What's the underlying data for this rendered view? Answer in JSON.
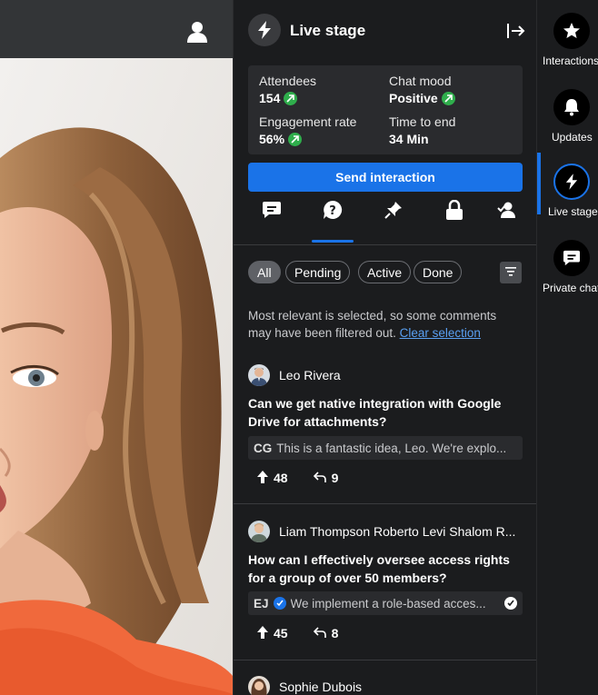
{
  "panel": {
    "title": "Live stage",
    "stats": {
      "attendees_label": "Attendees",
      "attendees_value": "154",
      "chat_mood_label": "Chat mood",
      "chat_mood_value": "Positive",
      "engagement_label": "Engagement rate",
      "engagement_value": "56%",
      "time_label": "Time to end",
      "time_value": "34 Min"
    },
    "send_button": "Send interaction",
    "tabs": [
      "chat-icon",
      "question-icon",
      "pin-icon",
      "lock-icon",
      "people-icon"
    ],
    "active_tab": 1,
    "filters": [
      {
        "label": "All",
        "active": true
      },
      {
        "label": "Pending",
        "active": false
      },
      {
        "label": "Active",
        "active": false
      },
      {
        "label": "Done",
        "active": false
      }
    ],
    "filter_note": "Most relevant is selected, so some comments may have been filtered out.",
    "clear_selection": "Clear selection",
    "questions": [
      {
        "author": "Leo Rivera",
        "question": "Can we get native integration with Google Drive for attachments?",
        "reply_initials": "CG",
        "reply_text": "This is a fantastic idea, Leo. We're explo...",
        "reply_verified": false,
        "reply_done": false,
        "upvotes": "48",
        "replies": "9"
      },
      {
        "author": "Liam Thompson Roberto Levi Shalom R...",
        "question": "How can I effectively oversee access rights for a group of over 50 members?",
        "reply_initials": "EJ",
        "reply_text": "We implement a role-based acces...",
        "reply_verified": true,
        "reply_done": true,
        "upvotes": "45",
        "replies": "8"
      },
      {
        "author": "Sophie Dubois"
      }
    ]
  },
  "rail": {
    "items": [
      {
        "label": "Interactions",
        "icon": "star-icon"
      },
      {
        "label": "Updates",
        "icon": "bell-icon"
      },
      {
        "label": "Live stage",
        "icon": "bolt-icon",
        "active": true
      },
      {
        "label": "Private chat",
        "icon": "chat-icon"
      }
    ]
  },
  "colors": {
    "accent": "#1a73e8",
    "panel_bg": "#1b1c1e",
    "trend_up": "#2fae4c"
  }
}
